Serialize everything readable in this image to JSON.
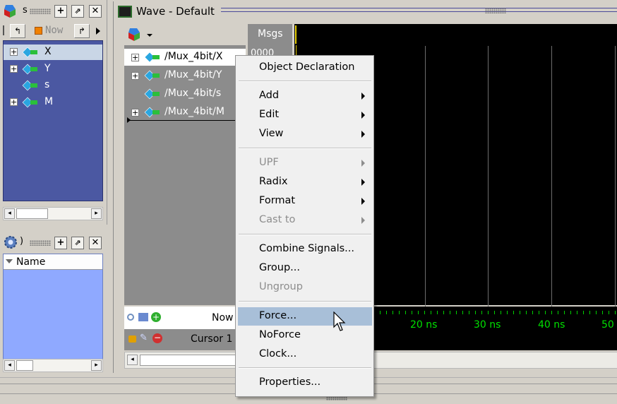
{
  "colors": {
    "accent_blue": "#4b58a2",
    "object_panel_bg": "#8fa9ff",
    "wave_bg": "#000000",
    "time_label": "#00e000",
    "menu_highlight": "#a8bfd8"
  },
  "objects_panel": {
    "title_fragment": "s",
    "now_label": "Now",
    "items": [
      {
        "label": "X",
        "expandable": true
      },
      {
        "label": "Y",
        "expandable": true
      },
      {
        "label": "s",
        "expandable": false
      },
      {
        "label": "M",
        "expandable": true
      }
    ]
  },
  "processes_panel": {
    "title_fragment": ")",
    "column_header": "Name"
  },
  "wave_window": {
    "title": "Wave - Default",
    "msgs_header": "Msgs",
    "signals": [
      {
        "label": "/Mux_4bit/X",
        "value": "0000"
      },
      {
        "label": "/Mux_4bit/Y",
        "value": ""
      },
      {
        "label": "/Mux_4bit/s",
        "value": ""
      },
      {
        "label": "/Mux_4bit/M",
        "value": ""
      }
    ],
    "now_label": "Now",
    "cursor_label": "Cursor 1",
    "time_labels": [
      "20 ns",
      "30 ns",
      "40 ns",
      "50"
    ]
  },
  "context_menu": {
    "items": [
      {
        "label": "Object Declaration",
        "submenu": false,
        "disabled": false,
        "highlight": false
      },
      {
        "label": "Add",
        "submenu": true,
        "disabled": false,
        "highlight": false
      },
      {
        "label": "Edit",
        "submenu": true,
        "disabled": false,
        "highlight": false
      },
      {
        "label": "View",
        "submenu": true,
        "disabled": false,
        "highlight": false
      },
      {
        "label": "UPF",
        "submenu": true,
        "disabled": true,
        "highlight": false
      },
      {
        "label": "Radix",
        "submenu": true,
        "disabled": false,
        "highlight": false
      },
      {
        "label": "Format",
        "submenu": true,
        "disabled": false,
        "highlight": false
      },
      {
        "label": "Cast to",
        "submenu": true,
        "disabled": true,
        "highlight": false
      },
      {
        "label": "Combine Signals...",
        "submenu": false,
        "disabled": false,
        "highlight": false
      },
      {
        "label": "Group...",
        "submenu": false,
        "disabled": false,
        "highlight": false
      },
      {
        "label": "Ungroup",
        "submenu": false,
        "disabled": true,
        "highlight": false
      },
      {
        "label": "Force...",
        "submenu": false,
        "disabled": false,
        "highlight": true
      },
      {
        "label": "NoForce",
        "submenu": false,
        "disabled": false,
        "highlight": false
      },
      {
        "label": "Clock...",
        "submenu": false,
        "disabled": false,
        "highlight": false
      },
      {
        "label": "Properties...",
        "submenu": false,
        "disabled": false,
        "highlight": false
      }
    ]
  }
}
